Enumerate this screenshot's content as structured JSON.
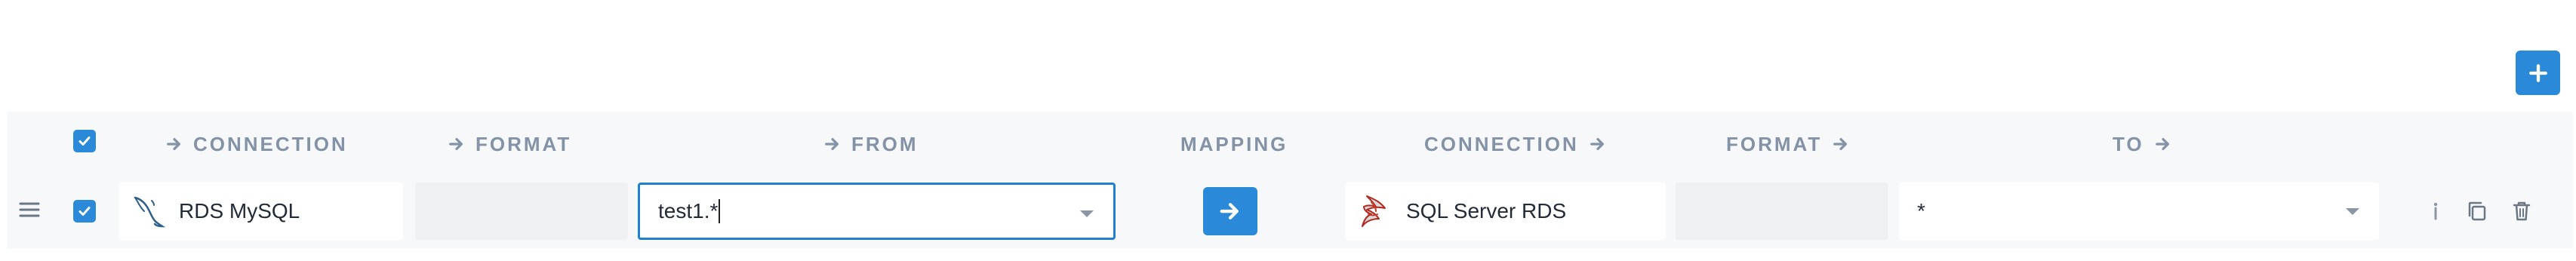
{
  "toolbar": {
    "add_icon": "plus-icon"
  },
  "header": {
    "select_all_checked": true,
    "columns": {
      "source_connection": "CONNECTION",
      "source_format": "FORMAT",
      "from": "FROM",
      "mapping": "MAPPING",
      "target_connection": "CONNECTION",
      "target_format": "FORMAT",
      "to": "TO"
    }
  },
  "row": {
    "checked": true,
    "source_connection": "RDS MySQL",
    "source_connection_icon": "mysql-dolphin-icon",
    "source_format": "",
    "from_value": "test1.*",
    "mapping_icon": "arrow-right-icon",
    "target_connection": "SQL Server RDS",
    "target_connection_icon": "sql-server-icon",
    "target_format": "",
    "to_value": "*",
    "actions": [
      "info-icon",
      "copy-icon",
      "trash-icon"
    ]
  },
  "colors": {
    "accent": "#2a8ad9",
    "header_text": "#8392a6",
    "row_bg": "#f6f8fa",
    "input_border": "#1f7fd3"
  }
}
